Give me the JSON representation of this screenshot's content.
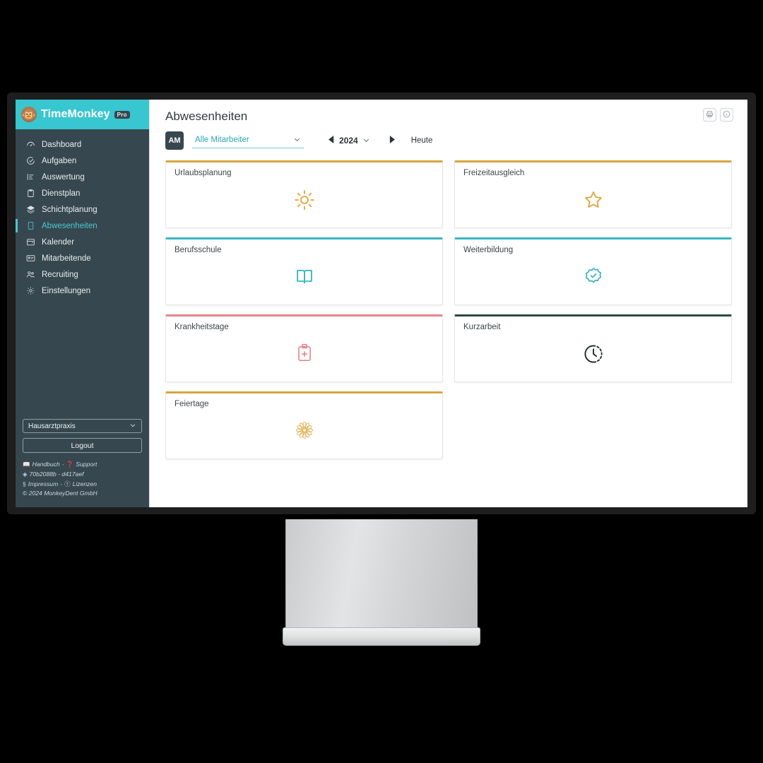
{
  "brand": {
    "logo_icon": "monkey-face-icon",
    "name": "TimeMonkey",
    "badge": "Pro",
    "bar_color": "#38c6d0"
  },
  "sidebar": {
    "background_color": "#37474f",
    "active_color": "#49c9cf",
    "items": [
      {
        "label": "Dashboard",
        "icon": "gauge-icon",
        "active": false
      },
      {
        "label": "Aufgaben",
        "icon": "check-circle-icon",
        "active": false
      },
      {
        "label": "Auswertung",
        "icon": "bar-chart-icon",
        "active": false
      },
      {
        "label": "Dienstplan",
        "icon": "clipboard-icon",
        "active": false
      },
      {
        "label": "Schichtplanung",
        "icon": "layers-icon",
        "active": false
      },
      {
        "label": "Abwesenheiten",
        "icon": "door-icon",
        "active": true
      },
      {
        "label": "Kalender",
        "icon": "calendar-icon",
        "active": false
      },
      {
        "label": "Mitarbeitende",
        "icon": "id-card-icon",
        "active": false
      },
      {
        "label": "Recruiting",
        "icon": "people-icon",
        "active": false
      },
      {
        "label": "Einstellungen",
        "icon": "gear-icon",
        "active": false
      }
    ],
    "org_select": {
      "value": "Hausarztpraxis",
      "caret_icon": "chevron-down-icon"
    },
    "logout_label": "Logout",
    "footer": {
      "line1": {
        "icon1": "book-icon",
        "link1": "Handbuch",
        "sep": "-",
        "icon2": "question-circle-icon",
        "link2": "Support"
      },
      "line2": {
        "icon1": "diamond-icon",
        "text": "70b2088b - d417aef"
      },
      "line3": {
        "icon1": "paragraph-icon",
        "link1": "Impressum",
        "sep": "-",
        "icon2": "copyright-badge-icon",
        "link2": "Lizenzen"
      },
      "line4": "© 2024 MonkeyDent GmbH"
    }
  },
  "header": {
    "title": "Abwesenheiten",
    "actions": [
      {
        "name": "print-button",
        "icon": "printer-icon"
      },
      {
        "name": "info-button",
        "icon": "info-circle-icon"
      }
    ]
  },
  "toolbar": {
    "avatar_initials": "AM",
    "employee_filter": {
      "value": "Alle Mitarbeiter",
      "caret_icon": "chevron-down-icon",
      "accent_color": "#2aa8b3"
    },
    "prev_icon": "triangle-left-icon",
    "year": "2024",
    "year_caret_icon": "chevron-down-icon",
    "next_icon": "triangle-right-icon",
    "today_label": "Heute"
  },
  "cards": [
    {
      "title": "Urlaubsplanung",
      "icon": "sun-icon",
      "color": "#d9a441"
    },
    {
      "title": "Freizeitausgleich",
      "icon": "star-icon",
      "color": "#d9a441"
    },
    {
      "title": "Berufsschule",
      "icon": "open-book-icon",
      "color": "#3ab6c4"
    },
    {
      "title": "Weiterbildung",
      "icon": "verified-badge-icon",
      "color": "#3ab6c4"
    },
    {
      "title": "Krankheitstage",
      "icon": "medical-clipboard-icon",
      "color": "#e8848b"
    },
    {
      "title": "Kurzarbeit",
      "icon": "clock-dashed-icon",
      "color": "#2e4a42"
    },
    {
      "title": "Feiertage",
      "icon": "flower-rosette-icon",
      "color": "#d9a441"
    }
  ]
}
